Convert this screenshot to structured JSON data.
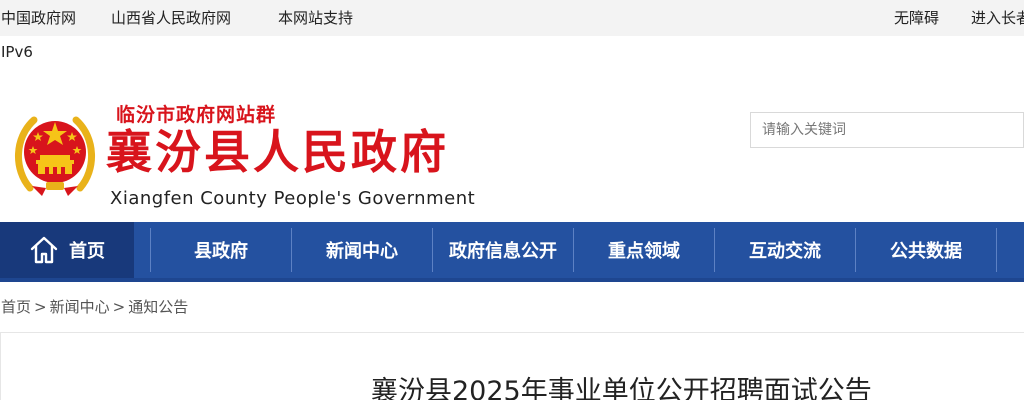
{
  "topbar": {
    "links": [
      "中国政府网",
      "山西省人民政府网",
      "本网站支持"
    ],
    "accessibility": "无障碍",
    "elder_mode": "进入长者"
  },
  "ipv6_label": "IPv6",
  "header": {
    "site_group": "临汾市政府网站群",
    "title": "襄汾县人民政府",
    "subtitle": "Xiangfen County People's Government"
  },
  "search": {
    "placeholder": "请输入关键词"
  },
  "nav": {
    "items": [
      {
        "label": "首页",
        "active": true
      },
      {
        "label": "县政府"
      },
      {
        "label": "新闻中心"
      },
      {
        "label": "政府信息公开"
      },
      {
        "label": "重点领域"
      },
      {
        "label": "互动交流"
      },
      {
        "label": "公共数据"
      }
    ]
  },
  "breadcrumb": [
    "首页",
    "新闻中心",
    "通知公告"
  ],
  "breadcrumb_sep": ">",
  "article": {
    "title": "襄汾县2025年事业单位公开招聘面试公告"
  },
  "colors": {
    "brand_red": "#d8141c",
    "nav_blue": "#2451a0",
    "nav_active": "#18397b"
  }
}
